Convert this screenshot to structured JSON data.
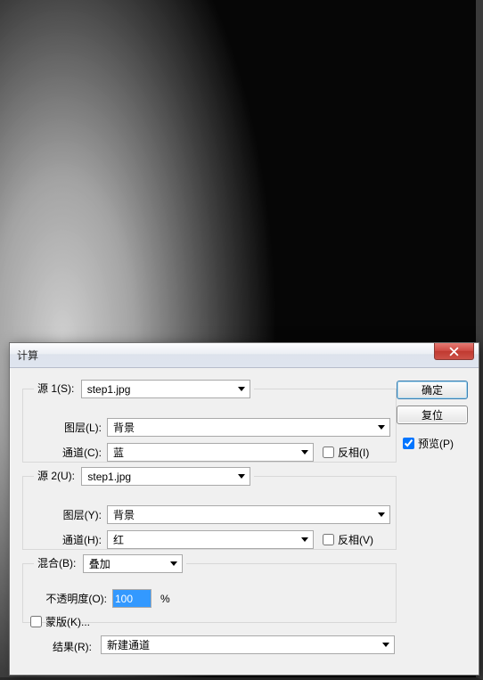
{
  "dialog": {
    "title": "计算",
    "source1": {
      "legend": "源 1(S):",
      "file": "step1.jpg",
      "layer_label": "图层(L):",
      "layer": "背景",
      "channel_label": "通道(C):",
      "channel": "蓝",
      "invert_label": "反相(I)"
    },
    "source2": {
      "legend": "源 2(U):",
      "file": "step1.jpg",
      "layer_label": "图层(Y):",
      "layer": "背景",
      "channel_label": "通道(H):",
      "channel": "红",
      "invert_label": "反相(V)"
    },
    "blending": {
      "legend": "混合(B):",
      "mode": "叠加",
      "opacity_label": "不透明度(O):",
      "opacity": "100",
      "opacity_unit": "%",
      "mask_label": "蒙版(K)..."
    },
    "result_label": "结果(R):",
    "result": "新建通道",
    "buttons": {
      "ok": "确定",
      "reset": "复位"
    },
    "preview_label": "预览(P)"
  }
}
